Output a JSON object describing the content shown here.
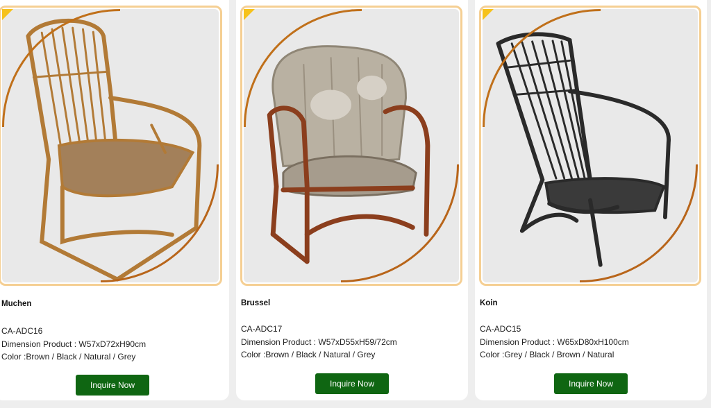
{
  "products": [
    {
      "name": "Muchen",
      "code": "CA-ADC16",
      "dimension": "Dimension Product : W57xD72xH90cm",
      "colors": "Color :Brown / Black / Natural / Grey",
      "button": "Inquire Now",
      "image_icon": "rattan-armchair-natural"
    },
    {
      "name": "Brussel",
      "code": "CA-ADC17",
      "dimension": "Dimension Product : W57xD55xH59/72cm",
      "colors": "Color :Brown / Black / Natural / Grey",
      "button": "Inquire Now",
      "image_icon": "rattan-armchair-cushioned-brown"
    },
    {
      "name": "Koin",
      "code": "CA-ADC15",
      "dimension": "Dimension Product : W65xD80xH100cm",
      "colors": "Color :Grey / Black / Brown / Natural",
      "button": "Inquire Now",
      "image_icon": "rattan-armchair-black"
    }
  ],
  "colors": {
    "button_bg": "#0f6612",
    "frame_border": "#f5cf93",
    "accent_arc": "#c0701a",
    "corner_gem": "#f6c21b"
  }
}
